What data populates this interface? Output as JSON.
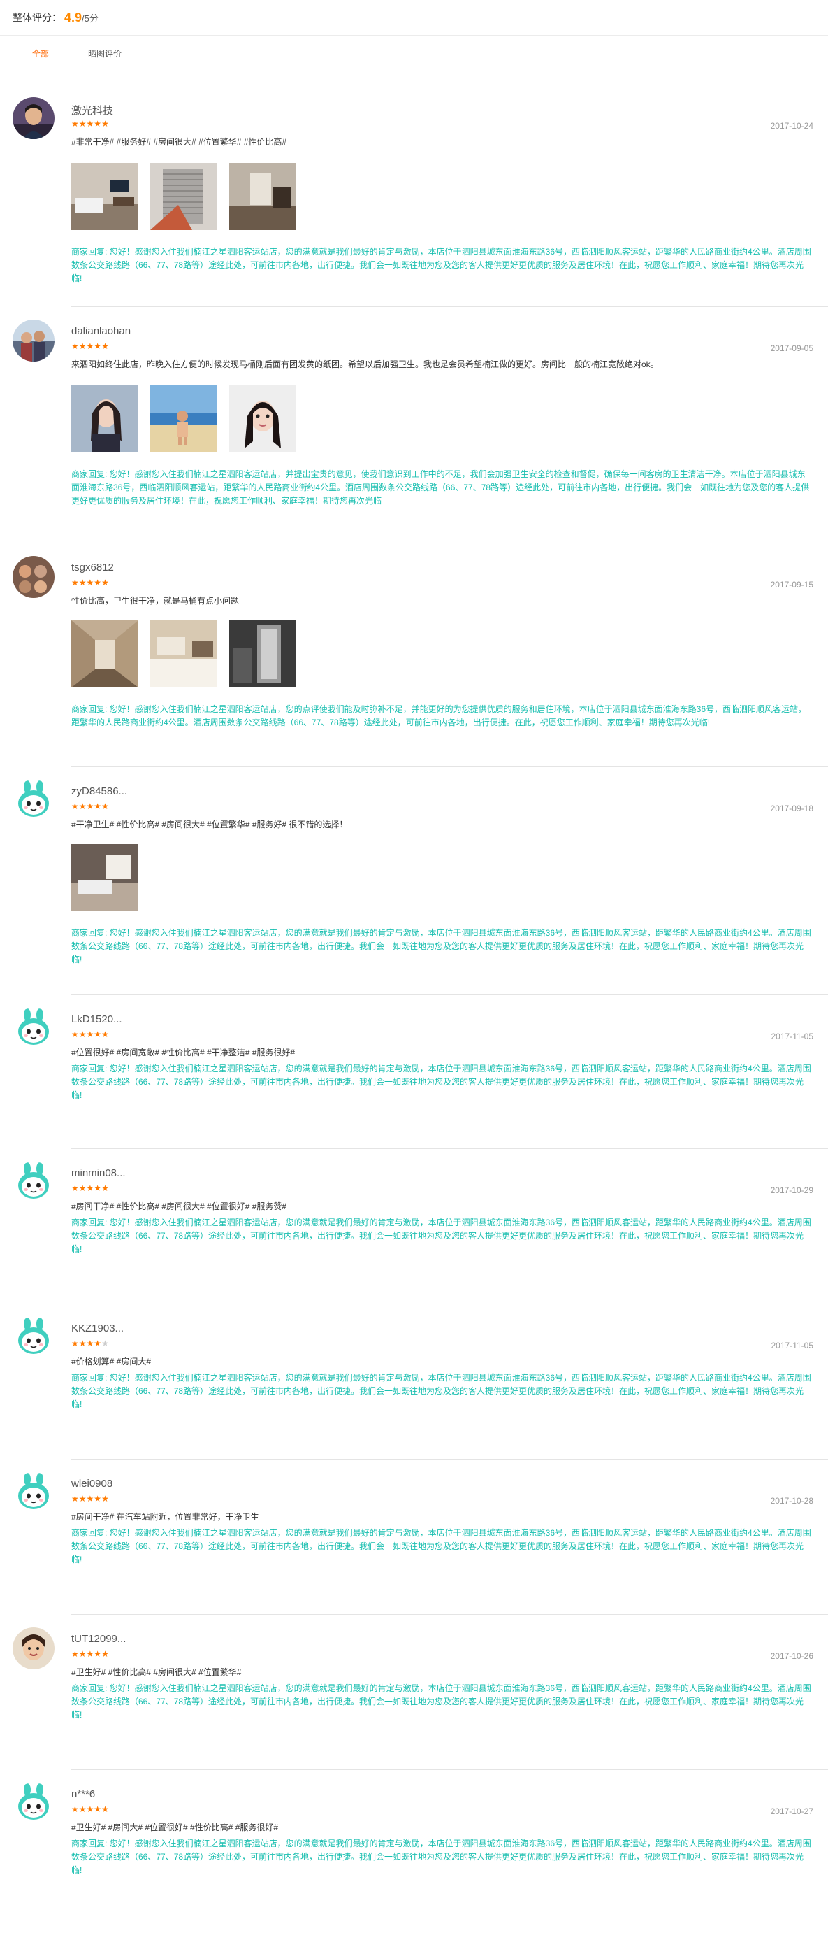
{
  "header": {
    "score_label": "整体评分：",
    "score": "4.9",
    "score_max": "/5分"
  },
  "tabs": [
    {
      "label": "全部",
      "active": true
    },
    {
      "label": "晒图评价",
      "active": false
    }
  ],
  "reviews": [
    {
      "user": "激光科技",
      "avatar": "photo-man-avatar",
      "rating": 5,
      "date": "2017-10-24",
      "content": "#非常干净# #服务好# #房间很大# #位置繁华# #性价比高#",
      "photos": [
        "hotel-room-photo",
        "window-curtain-photo",
        "room-corner-photo"
      ],
      "reply": "商家回复: 您好！感谢您入住我们楠江之星泗阳客运站店，您的满意就是我们最好的肯定与激励，本店位于泗阳县城东面淮海东路36号，西临泗阳顺风客运站，距繁华的人民路商业街约4公里。酒店周围数条公交路线路（66、77、78路等）途经此处，可前往市内各地，出行便捷。我们会一如既往地为您及您的客人提供更好更优质的服务及居住环境！在此，祝愿您工作顺利、家庭幸福！期待您再次光临!"
    },
    {
      "user": "dalianlaohan",
      "avatar": "photo-group-avatar",
      "rating": 5,
      "date": "2017-09-05",
      "content": "来泗阳如终住此店，昨晚入住方便的时候发现马桶刚后面有团发黄的纸团。希望以后加强卫生。我也是会员希望楠江做的更好。房间比一般的楠江宽敞绝对ok。",
      "photos": [
        "girl-selfie-photo",
        "beach-child-photo",
        "girl-portrait-photo"
      ],
      "reply": "商家回复: 您好！感谢您入住我们楠江之星泗阳客运站店，并提出宝贵的意见，使我们意识到工作中的不足，我们会加强卫生安全的检查和督促，确保每一间客房的卫生清洁干净。本店位于泗阳县城东面淮海东路36号，西临泗阳顺风客运站，距繁华的人民路商业街约4公里。酒店周围数条公交路线路（66、77、78路等）途经此处，可前往市内各地，出行便捷。我们会一如既往地为您及您的客人提供更好更优质的服务及居住环境！在此，祝愿您工作顺利、家庭幸福！期待您再次光临"
    },
    {
      "user": "tsgx6812",
      "avatar": "photo-faces-avatar",
      "rating": 5,
      "date": "2017-09-15",
      "content": "性价比高，卫生很干净，就是马桶有点小问题",
      "photos": [
        "hallway-photo",
        "bedroom-photo",
        "bathroom-photo"
      ],
      "reply": "商家回复: 您好！感谢您入住我们楠江之星泗阳客运站店，您的点评使我们能及时弥补不足，并能更好的为您提供优质的服务和居住环境，本店位于泗阳县城东面淮海东路36号，西临泗阳顺风客运站，距繁华的人民路商业街约4公里。酒店周围数条公交路线路（66、77、78路等）途经此处，可前往市内各地，出行便捷。在此，祝愿您工作顺利、家庭幸福！期待您再次光临!"
    },
    {
      "user": "zyD84586...",
      "avatar": "mascot-avatar",
      "rating": 5,
      "date": "2017-09-18",
      "content": "#干净卫生# #性价比高# #房间很大# #位置繁华# #服务好# 很不错的选择！",
      "photos": [
        "room-bed-photo"
      ],
      "reply": "商家回复: 您好！感谢您入住我们楠江之星泗阳客运站店，您的满意就是我们最好的肯定与激励，本店位于泗阳县城东面淮海东路36号，西临泗阳顺风客运站，距繁华的人民路商业街约4公里。酒店周围数条公交路线路（66、77、78路等）途经此处，可前往市内各地，出行便捷。我们会一如既往地为您及您的客人提供更好更优质的服务及居住环境！在此，祝愿您工作顺利、家庭幸福！期待您再次光临!"
    },
    {
      "user": "LkD1520...",
      "avatar": "mascot-avatar",
      "rating": 5,
      "date": "2017-11-05",
      "content": "#位置很好# #房间宽敞# #性价比高# #干净整洁# #服务很好#",
      "photos": [],
      "reply": "商家回复: 您好！感谢您入住我们楠江之星泗阳客运站店，您的满意就是我们最好的肯定与激励，本店位于泗阳县城东面淮海东路36号，西临泗阳顺风客运站，距繁华的人民路商业街约4公里。酒店周围数条公交路线路（66、77、78路等）途经此处，可前往市内各地，出行便捷。我们会一如既往地为您及您的客人提供更好更优质的服务及居住环境！在此，祝愿您工作顺利、家庭幸福！期待您再次光临!"
    },
    {
      "user": "minmin08...",
      "avatar": "mascot-avatar",
      "rating": 5,
      "date": "2017-10-29",
      "content": "#房间干净# #性价比高# #房间很大# #位置很好# #服务赞#",
      "photos": [],
      "reply": "商家回复: 您好！感谢您入住我们楠江之星泗阳客运站店，您的满意就是我们最好的肯定与激励，本店位于泗阳县城东面淮海东路36号，西临泗阳顺风客运站，距繁华的人民路商业街约4公里。酒店周围数条公交路线路（66、77、78路等）途经此处，可前往市内各地，出行便捷。我们会一如既往地为您及您的客人提供更好更优质的服务及居住环境！在此，祝愿您工作顺利、家庭幸福！期待您再次光临!"
    },
    {
      "user": "KKZ1903...",
      "avatar": "mascot-avatar",
      "rating": 4,
      "date": "2017-11-05",
      "content": "#价格划算# #房间大#",
      "photos": [],
      "reply": "商家回复: 您好！感谢您入住我们楠江之星泗阳客运站店，您的满意就是我们最好的肯定与激励，本店位于泗阳县城东面淮海东路36号，西临泗阳顺风客运站，距繁华的人民路商业街约4公里。酒店周围数条公交路线路（66、77、78路等）途经此处，可前往市内各地，出行便捷。我们会一如既往地为您及您的客人提供更好更优质的服务及居住环境！在此，祝愿您工作顺利、家庭幸福！期待您再次光临!"
    },
    {
      "user": "wlei0908",
      "avatar": "mascot-avatar",
      "rating": 5,
      "date": "2017-10-28",
      "content": "#房间干净# 在汽车站附近，位置非常好，干净卫生",
      "photos": [],
      "reply": "商家回复: 您好！感谢您入住我们楠江之星泗阳客运站店，您的满意就是我们最好的肯定与激励，本店位于泗阳县城东面淮海东路36号，西临泗阳顺风客运站，距繁华的人民路商业街约4公里。酒店周围数条公交路线路（66、77、78路等）途经此处，可前往市内各地，出行便捷。我们会一如既往地为您及您的客人提供更好更优质的服务及居住环境！在此，祝愿您工作顺利、家庭幸福！期待您再次光临!"
    },
    {
      "user": "tUT12099...",
      "avatar": "photo-child-avatar",
      "rating": 5,
      "date": "2017-10-26",
      "content": "#卫生好# #性价比高# #房间很大# #位置繁华#",
      "photos": [],
      "reply": "商家回复: 您好！感谢您入住我们楠江之星泗阳客运站店，您的满意就是我们最好的肯定与激励，本店位于泗阳县城东面淮海东路36号，西临泗阳顺风客运站，距繁华的人民路商业街约4公里。酒店周围数条公交路线路（66、77、78路等）途经此处，可前往市内各地，出行便捷。我们会一如既往地为您及您的客人提供更好更优质的服务及居住环境！在此，祝愿您工作顺利、家庭幸福！期待您再次光临!"
    },
    {
      "user": "n***6",
      "avatar": "mascot-avatar",
      "rating": 5,
      "date": "2017-10-27",
      "content": "#卫生好# #房间大# #位置很好# #性价比高# #服务很好#",
      "photos": [],
      "reply": "商家回复: 您好！感谢您入住我们楠江之星泗阳客运站店，您的满意就是我们最好的肯定与激励，本店位于泗阳县城东面淮海东路36号，西临泗阳顺风客运站，距繁华的人民路商业街约4公里。酒店周围数条公交路线路（66、77、78路等）途经此处，可前往市内各地，出行便捷。我们会一如既往地为您及您的客人提供更好更优质的服务及居住环境！在此，祝愿您工作顺利、家庭幸福！期待您再次光临!"
    }
  ]
}
